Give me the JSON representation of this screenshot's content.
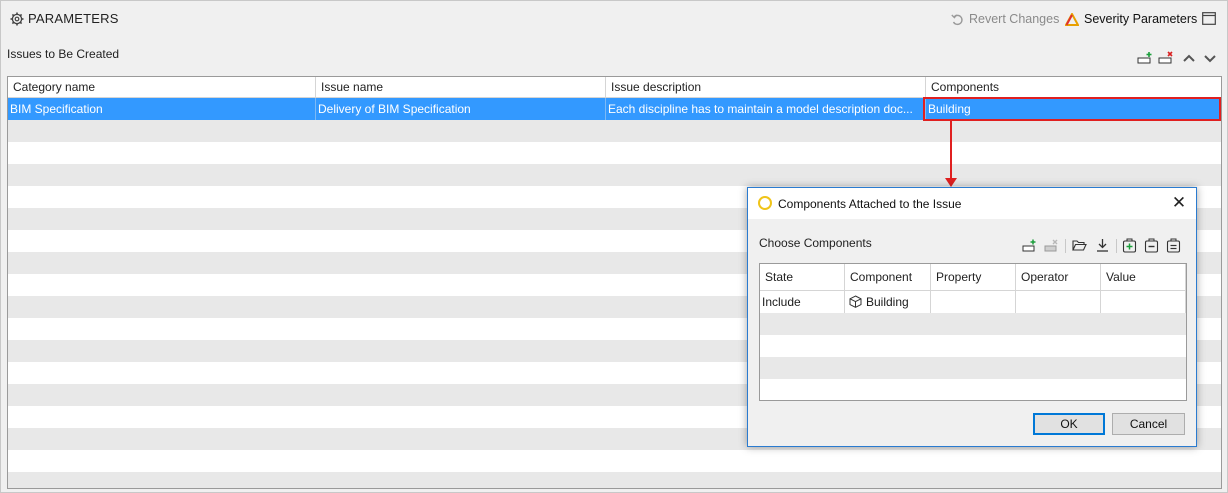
{
  "header": {
    "title": "PARAMETERS",
    "revert_label": "Revert Changes",
    "severity_label": "Severity Parameters",
    "icons": [
      "gear-icon",
      "revert-icon",
      "severity-icon",
      "maximize-icon"
    ]
  },
  "issues": {
    "section_title": "Issues to Be Created",
    "toolbar_icons": [
      "add-row-icon",
      "delete-row-icon",
      "move-up-icon",
      "move-down-icon"
    ],
    "columns": [
      "Category name",
      "Issue name",
      "Issue description",
      "Components"
    ],
    "rows": [
      {
        "category": "BIM Specification",
        "issue": "Delivery of BIM Specification",
        "description": "Each discipline has to maintain a model description doc...",
        "components": "Building"
      }
    ]
  },
  "dialog": {
    "title": "Components Attached to the Issue",
    "section_title": "Choose Components",
    "toolbar_icons": [
      "add-row-icon",
      "delete-row-icon",
      "open-folder-icon",
      "download-icon",
      "add-item-icon",
      "remove-item-icon",
      "clear-item-icon"
    ],
    "columns": [
      "State",
      "Component",
      "Property",
      "Operator",
      "Value"
    ],
    "rows": [
      {
        "state": "Include",
        "component": "Building",
        "property": "",
        "operator": "",
        "value": ""
      }
    ],
    "ok_label": "OK",
    "cancel_label": "Cancel"
  },
  "colors": {
    "selection": "#3399ff",
    "highlight_border": "#e02020",
    "dialog_border": "#2a7bd0"
  }
}
